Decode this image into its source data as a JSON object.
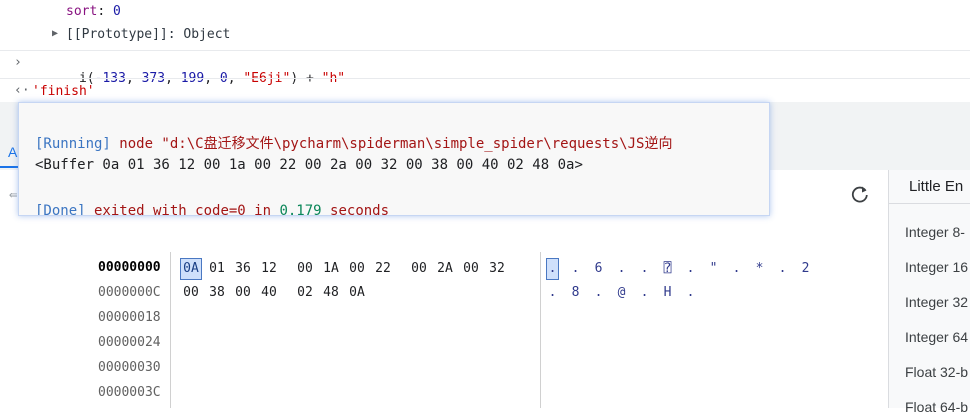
{
  "console": {
    "prop_line_key": "sort",
    "prop_line_value": "0",
    "prototype_label": "[[Prototype]]: Object",
    "input_prefix": "i(",
    "input_args": [
      "-133",
      "373",
      "199",
      "0"
    ],
    "input_str1": "\"E6ji\"",
    "input_suffix": ") + ",
    "input_str2": "\"h\"",
    "result": "'finish'"
  },
  "popup": {
    "line1_tag": "[Running]",
    "line1_cmd": " node \"d:\\C盘迁移文件\\pycharm\\spiderman\\simple_spider\\requests\\JS逆向",
    "line2": "<Buffer 0a 01 36 12 00 1a 00 22 00 2a 00 32 00 38 00 40 02 48 0a>",
    "line3_tag": "[Done]",
    "line3_text": " exited with code=0 in ",
    "line3_time": "0.179",
    "line3_unit": " seconds"
  },
  "tab_label": "A",
  "hex": {
    "offsets": [
      "00000000",
      "0000000C",
      "00000018",
      "00000024",
      "00000030",
      "0000003C"
    ],
    "rows": [
      [
        "0A",
        "01",
        "36",
        "12",
        "00",
        "1A",
        "00",
        "22",
        "00",
        "2A",
        "00",
        "32"
      ],
      [
        "00",
        "38",
        "00",
        "40",
        "02",
        "48",
        "0A"
      ]
    ],
    "ascii": [
      [
        ".",
        ".",
        "6",
        ".",
        ".",
        "⍰",
        ".",
        "\"",
        ".",
        "*",
        ".",
        "2"
      ],
      [
        ".",
        "8",
        ".",
        "@",
        ".",
        "H",
        "."
      ]
    ]
  },
  "inspector": {
    "title": "Little En",
    "items": [
      "Integer 8-",
      "Integer 16",
      "Integer 32",
      "Integer 64",
      "Float 32-b",
      "Float 64-b"
    ]
  }
}
